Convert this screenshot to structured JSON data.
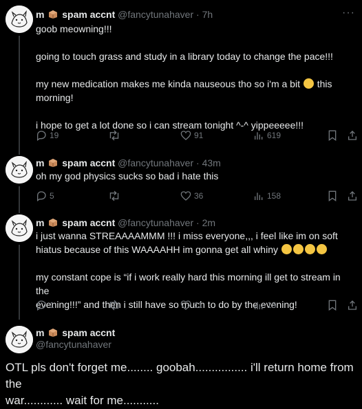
{
  "tweets": [
    {
      "name": "m",
      "name_suffix": "spam accnt",
      "handle": "@fancytunahaver",
      "time": "7h",
      "body": {
        "p1": "goob meowning!!!",
        "p2": "going to touch grass and study in a library today to change the pace!!!",
        "p3a": "my new medication makes me kinda nauseous tho so i'm a bit",
        "p3b": "this",
        "p3c": "morning!",
        "p4": "i hope to get a lot done so i can stream tonight ^-^ yippeeeee!!!"
      },
      "stats": {
        "replies": "19",
        "reposts": "",
        "likes": "91",
        "views": "619"
      }
    },
    {
      "name": "m",
      "name_suffix": "spam accnt",
      "handle": "@fancytunahaver",
      "time": "43m",
      "body": {
        "p1": "oh my god physics sucks so bad i hate this"
      },
      "stats": {
        "replies": "5",
        "reposts": "",
        "likes": "36",
        "views": "158"
      }
    },
    {
      "name": "m",
      "name_suffix": "spam accnt",
      "handle": "@fancytunahaver",
      "time": "2m",
      "body": {
        "p1a": "i just wanna STREAAAAMMM !!! i miss everyone,,, i feel like im on soft",
        "p1b": "hiatus because of this WAAAAHH im gonna get all whiny",
        "p2a": "my constant cope is “if i work really hard this morning ill get to stream in the",
        "p2b": "evening!!!” and then i still have so much to do by the evening!"
      },
      "stats": {
        "replies": "1",
        "reposts": "",
        "likes": "11",
        "views": "13"
      }
    },
    {
      "name": "m",
      "name_suffix": "spam accnt",
      "handle": "@fancytunahaver",
      "body": {
        "l1": "OTL pls don't forget me........ goobah................ i'll return home from the",
        "l2": "war............ wait for me..........."
      }
    }
  ],
  "icons": {
    "reply": "reply-icon",
    "repost": "repost-icon",
    "like": "heart-icon",
    "views": "views-icon",
    "bookmark": "bookmark-icon",
    "share": "share-icon",
    "more": "more-icon"
  },
  "colors": {
    "background": "#000000",
    "text": "#e7e9ea",
    "muted": "#71767b",
    "divider": "#2f3336"
  }
}
